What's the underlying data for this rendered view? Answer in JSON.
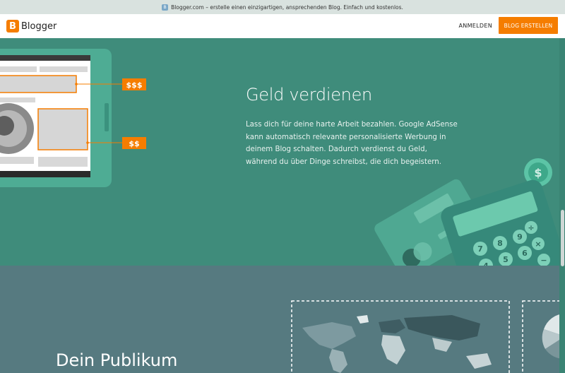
{
  "titlebar": {
    "text": "Blogger.com – erstelle einen einzigartigen, ansprechenden Blog. Einfach und kostenlos."
  },
  "header": {
    "logo": "Blogger",
    "login": "ANMELDEN",
    "create": "BLOG ERSTELLEN"
  },
  "hero": {
    "tags": [
      "$$$",
      "$$"
    ],
    "title": "Geld verdienen",
    "description": "Lass dich für deine harte Arbeit bezahlen. Google AdSense kann automatisch relevante personalisierte Werbung in deinem Blog schalten. Dadurch verdienst du Geld, während du über Dinge schreibst, die dich begeistern.",
    "calculator_keys": [
      "7",
      "8",
      "9",
      "4",
      "5",
      "6",
      "÷",
      "×",
      "−"
    ]
  },
  "audience": {
    "title": "Dein Publikum"
  }
}
